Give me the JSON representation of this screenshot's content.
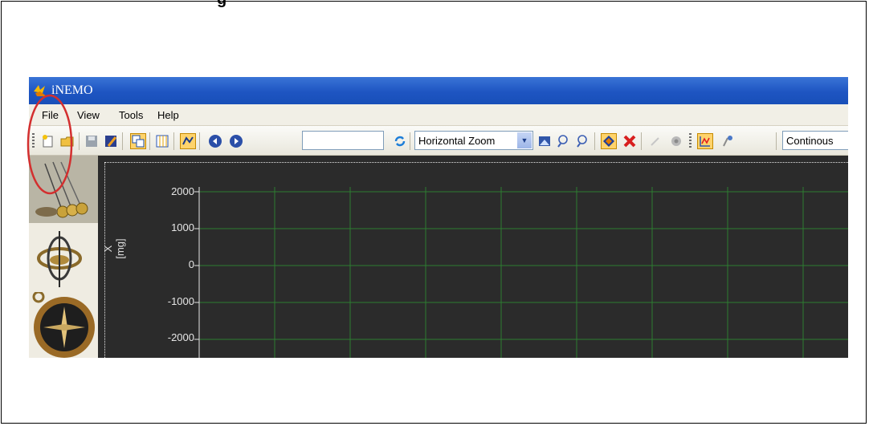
{
  "figure": {
    "heading": "g"
  },
  "app": {
    "title": "iNEMO"
  },
  "menu": {
    "items": [
      "File",
      "View",
      "Tools",
      "Help"
    ]
  },
  "toolbar": {
    "zoom_mode": "Horizontal Zoom",
    "acquisition_mode": "Continous",
    "search_value": ""
  },
  "sidebar": {
    "items": [
      "pendulum-accelerometer",
      "gyroscope",
      "compass-magnetometer"
    ]
  },
  "plot": {
    "ylabel": "X [mg]",
    "ticks": [
      "2000",
      "1000",
      "0",
      "-1000",
      "-2000"
    ]
  },
  "chart_data": {
    "type": "line",
    "ylabel": "X [mg]",
    "yticks": [
      2000,
      1000,
      0,
      -1000,
      -2000
    ],
    "ylim": [
      -2000,
      2000
    ],
    "grid": true,
    "series": []
  },
  "colors": {
    "plot_bg": "#2b2b2b",
    "grid": "#2e7d32",
    "highlight": "#d32f2f"
  }
}
